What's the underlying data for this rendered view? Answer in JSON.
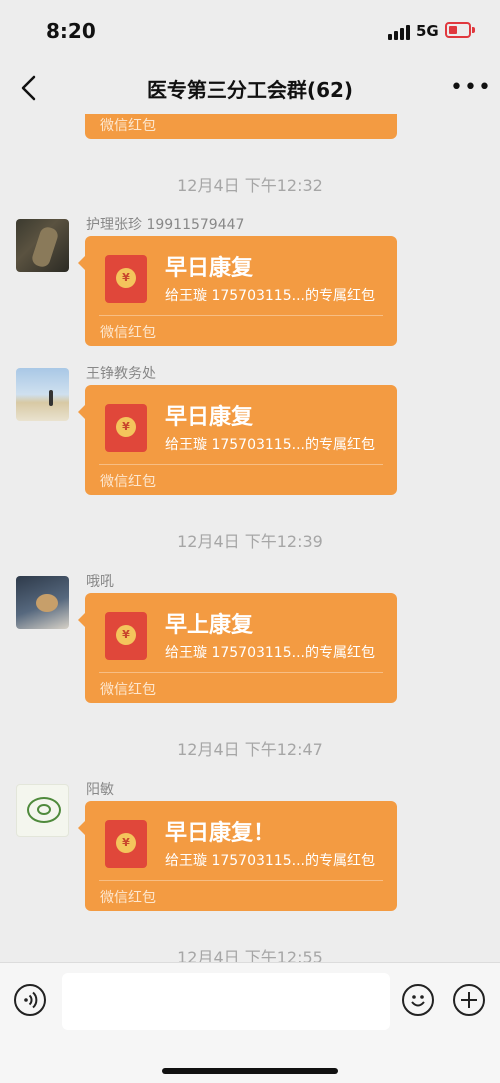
{
  "status_bar": {
    "time": "8:20",
    "network": "5G"
  },
  "nav": {
    "title": "医专第三分工会群(62)",
    "more_label": "•••"
  },
  "packet_footer": "微信红包",
  "messages": [
    {
      "timestamp": "12月4日 下午12:32",
      "sender": "护理张珍  19911579447",
      "text": "早日康复",
      "subtitle": "给王璇 175703115...的专属红包"
    },
    {
      "timestamp": "",
      "sender": "王铮教务处",
      "text": "早日康复",
      "subtitle": "给王璇 175703115...的专属红包"
    },
    {
      "timestamp": "12月4日 下午12:39",
      "sender": "哦吼",
      "text": "早上康复",
      "subtitle": "给王璇 175703115...的专属红包"
    },
    {
      "timestamp": "12月4日 下午12:47",
      "sender": "阳敏",
      "text": "早日康复！",
      "subtitle": "给王璇 175703115...的专属红包"
    }
  ],
  "last_timestamp": "12月4日 下午12:55",
  "input": {
    "placeholder": ""
  },
  "icons": {
    "back": "chevron-left-icon",
    "voice": "voice-icon",
    "emoji": "emoji-icon",
    "plus": "plus-icon",
    "redpacket": "red-envelope-icon"
  },
  "colors": {
    "packet": "#f39b42",
    "envelope": "#e0473a",
    "background": "#ededed"
  }
}
